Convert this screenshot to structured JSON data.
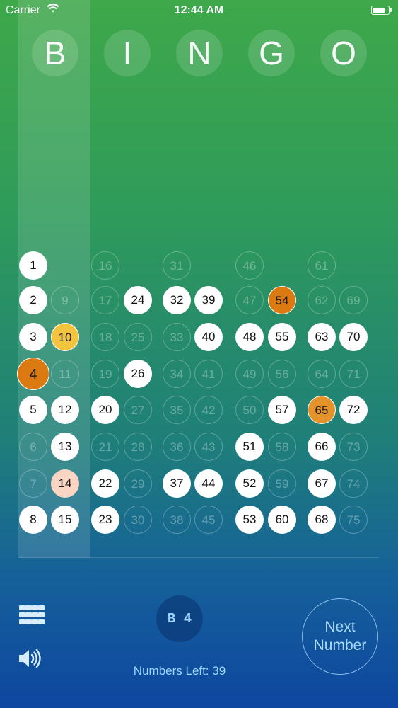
{
  "status_bar": {
    "carrier": "Carrier",
    "time": "12:44 AM",
    "battery_level": 0.85
  },
  "header": {
    "letters": [
      "B",
      "I",
      "N",
      "G",
      "O"
    ]
  },
  "board": {
    "current_number": 4,
    "called_numbers": [
      1,
      2,
      3,
      4,
      5,
      8,
      10,
      12,
      13,
      14,
      15,
      20,
      22,
      23,
      24,
      26,
      32,
      37,
      39,
      40,
      44,
      48,
      51,
      52,
      53,
      54,
      55,
      57,
      60,
      63,
      65,
      66,
      67,
      68,
      70,
      72
    ],
    "highlighted": {
      "4": "orange",
      "54": "orange",
      "10": "gold",
      "65": "amber",
      "14": "peach"
    }
  },
  "controls": {
    "current_call": "B 4",
    "next_button": {
      "line1": "Next",
      "line2": "Number"
    },
    "numbers_left_label": "Numbers Left: 39"
  },
  "icons": {
    "grid": "grid-icon",
    "sound": "speaker-icon",
    "wifi": "wifi-icon",
    "battery": "battery-icon"
  }
}
